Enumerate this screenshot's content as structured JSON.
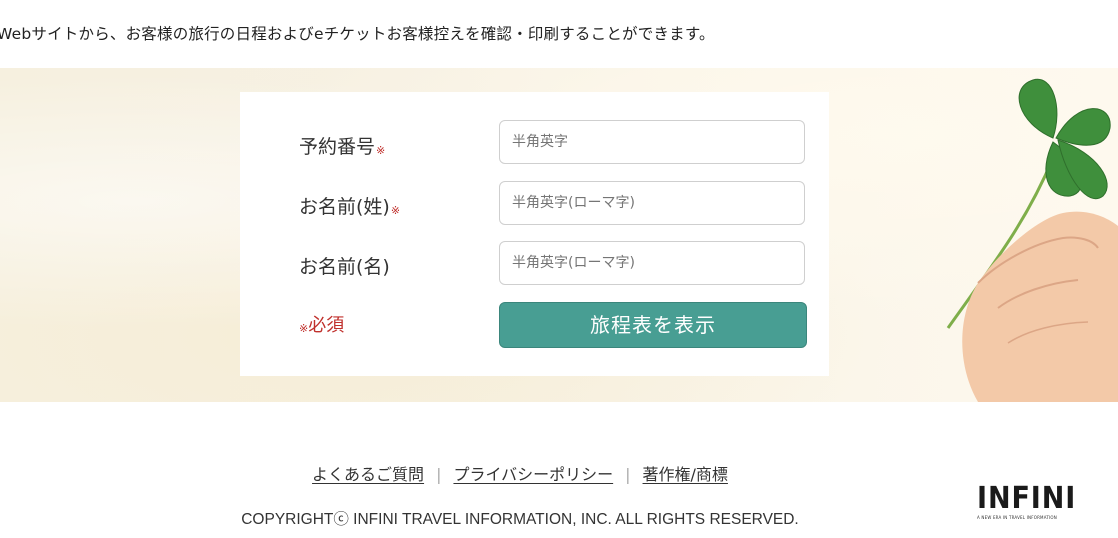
{
  "intro": "Webサイトから、お客様の旅行の日程およびeチケットお客様控えを確認・印刷することができます。",
  "form": {
    "fields": [
      {
        "label": "予約番号",
        "required_mark": "※",
        "placeholder": "半角英字"
      },
      {
        "label": "お名前(姓)",
        "required_mark": "※",
        "placeholder": "半角英字(ローマ字)"
      },
      {
        "label": "お名前(名)",
        "placeholder": "半角英字(ローマ字)"
      }
    ],
    "required_note_mark": "※",
    "required_note": "必須",
    "submit_label": "旅程表を表示"
  },
  "footer": {
    "links": [
      "よくあるご質問",
      "プライバシーポリシー",
      "著作権/商標"
    ],
    "separator": "|",
    "copyright": "COPYRIGHTⓒ INFINI TRAVEL INFORMATION, INC. ALL RIGHTS RESERVED."
  },
  "logo": {
    "text": "INFINI",
    "tagline": "A NEW ERA IN TRAVEL INFORMATION"
  },
  "colors": {
    "accent": "#489e93",
    "required": "#c0302c",
    "hero_bg": "#f6f0df"
  },
  "icons": {
    "hero_image": "hand-holding-clover-icon"
  }
}
